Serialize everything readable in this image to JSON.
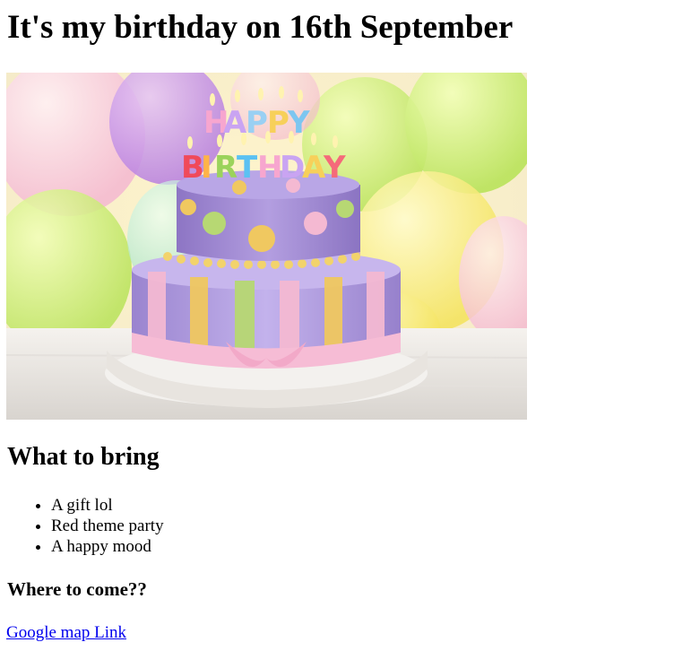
{
  "title": "It's my birthday on 16th September",
  "image": {
    "description_icon": "birthday-cake-image",
    "candle_letters_top": "HAPPY",
    "candle_letters_bottom": "BIRTHDAY"
  },
  "what_to_bring": {
    "heading": "What to bring",
    "items": [
      "A gift lol",
      "Red theme party",
      "A happy mood"
    ]
  },
  "where": {
    "heading": "Where to come??",
    "link_text": "Google map Link"
  },
  "colors": {
    "link": "#0000ee",
    "text": "#000000",
    "background": "#ffffff"
  }
}
